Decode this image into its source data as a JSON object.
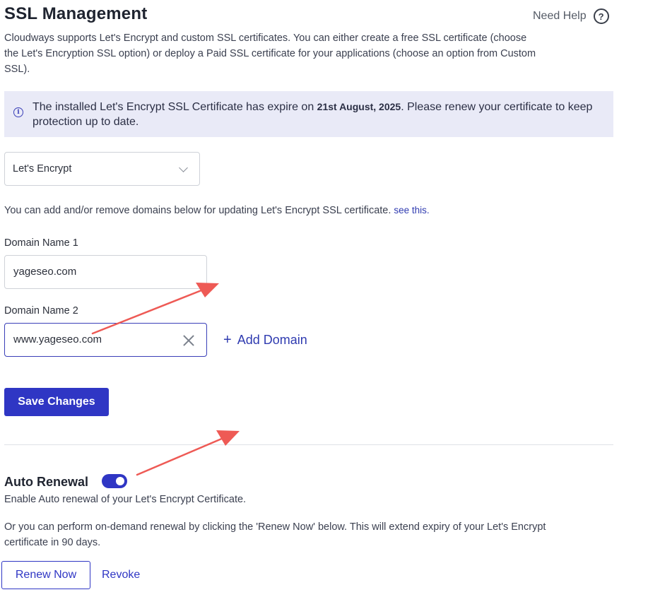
{
  "header": {
    "title": "SSL Management",
    "help_label": "Need Help",
    "help_icon": "question-circle-icon"
  },
  "intro": "Cloudways supports Let's Encrypt and custom SSL certificates. You can either create a free SSL certificate (choose the Let's Encryption SSL option) or deploy a Paid SSL certificate for your applications (choose an option from Custom SSL).",
  "notice": {
    "icon": "info-icon",
    "text_before": "The installed Let's Encrypt SSL Certificate has expire on ",
    "date": "21st August, 2025",
    "text_after": ". Please renew your certificate to keep protection up to date."
  },
  "ssl_type": {
    "selected": "Let's Encrypt"
  },
  "hint": {
    "text": "You can add and/or remove domains below for updating Let's Encrypt SSL certificate. ",
    "link": "see this."
  },
  "domains": [
    {
      "label": "Domain Name 1",
      "value": "yageseo.com"
    },
    {
      "label": "Domain Name 2",
      "value": "www.yageseo.com"
    }
  ],
  "add_domain": {
    "plus": "+",
    "label": "Add Domain"
  },
  "save_label": "Save Changes",
  "auto_renewal": {
    "title": "Auto Renewal",
    "enabled": true,
    "description": "Enable Auto renewal of your Let's Encrypt Certificate.",
    "ondemand_text": "Or you can perform on-demand renewal by clicking the 'Renew Now' below. This will extend expiry of your Let's Encrypt certificate in 90 days."
  },
  "actions": {
    "renew_label": "Renew Now",
    "revoke_label": "Revoke"
  },
  "colors": {
    "primary": "#2f36c4",
    "notice_bg": "#e9eaf7",
    "annotation_arrow": "#ee5a55"
  }
}
